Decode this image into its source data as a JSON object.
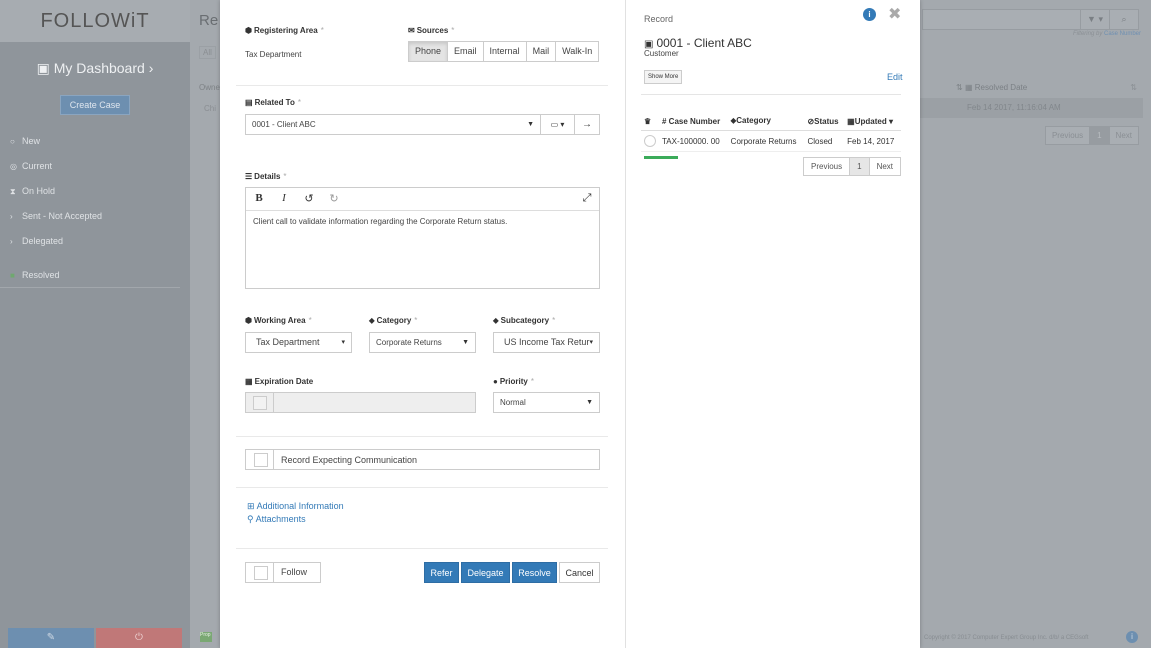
{
  "background": {
    "logo": "FOLLOWiT",
    "dashboard_title": "My Dashboard",
    "create_case": "Create Case",
    "nav": [
      {
        "icon": "circle-icon",
        "label": "New"
      },
      {
        "icon": "target-icon",
        "label": "Current"
      },
      {
        "icon": "hourglass-icon",
        "label": "On Hold"
      },
      {
        "icon": "chevron-right-icon",
        "label": "Sent - Not Accepted"
      },
      {
        "icon": "chevron-right-icon",
        "label": "Delegated"
      },
      {
        "icon": "square-icon",
        "label": "Resolved"
      }
    ],
    "page_title_partial": "Re",
    "filter_all": "All",
    "owner_col": "Owne",
    "row_partial": "Chi",
    "filtering_by_prefix": "Filtering by",
    "filtering_by_value": "Case Number",
    "resolved_date_col": "Resolved Date",
    "row_resolved_date": "Feb 14 2017, 11:16:04 AM",
    "pager": {
      "previous": "Previous",
      "page": "1",
      "next": "Next"
    },
    "copyright": "Copyright © 2017 Computer Expert Group Inc. d/b/ a CEGsoft",
    "status_badge": "Prop"
  },
  "form": {
    "registering_area": {
      "label": "Registering Area",
      "value": "Tax Department"
    },
    "sources": {
      "label": "Sources",
      "options": [
        "Phone",
        "Email",
        "Internal",
        "Mail",
        "Walk-In"
      ],
      "selected": "Phone"
    },
    "related_to": {
      "label": "Related To",
      "value": "0001 - Client ABC"
    },
    "details": {
      "label": "Details",
      "text": "Client call to validate information regarding the Corporate Return status."
    },
    "working_area": {
      "label": "Working Area",
      "value": "Tax Department"
    },
    "category": {
      "label": "Category",
      "value": "Corporate Returns"
    },
    "subcategory": {
      "label": "Subcategory",
      "value": "US Income Tax Retur"
    },
    "expiration_date": {
      "label": "Expiration Date",
      "value": ""
    },
    "priority": {
      "label": "Priority",
      "value": "Normal"
    },
    "record_expecting": "Record Expecting Communication",
    "additional_info": "Additional Information",
    "attachments": "Attachments",
    "follow": "Follow",
    "buttons": {
      "refer": "Refer",
      "delegate": "Delegate",
      "resolve": "Resolve",
      "cancel": "Cancel"
    },
    "required_mark": "*"
  },
  "record": {
    "title": "Record",
    "name": "0001 - Client ABC",
    "type": "Customer",
    "show_more": "Show More",
    "edit": "Edit",
    "table": {
      "headers": [
        "# Case Number",
        "Category",
        "Status",
        "Updated"
      ],
      "rows": [
        {
          "case_number": "TAX-100000. 00",
          "category": "Corporate Returns",
          "status": "Closed",
          "updated": "Feb 14, 2017"
        }
      ]
    },
    "pager": {
      "previous": "Previous",
      "page": "1",
      "next": "Next"
    }
  },
  "colors": {
    "accent": "#337ab7",
    "success": "#3bab5a",
    "overlay_gray": "#9aa0a6"
  }
}
